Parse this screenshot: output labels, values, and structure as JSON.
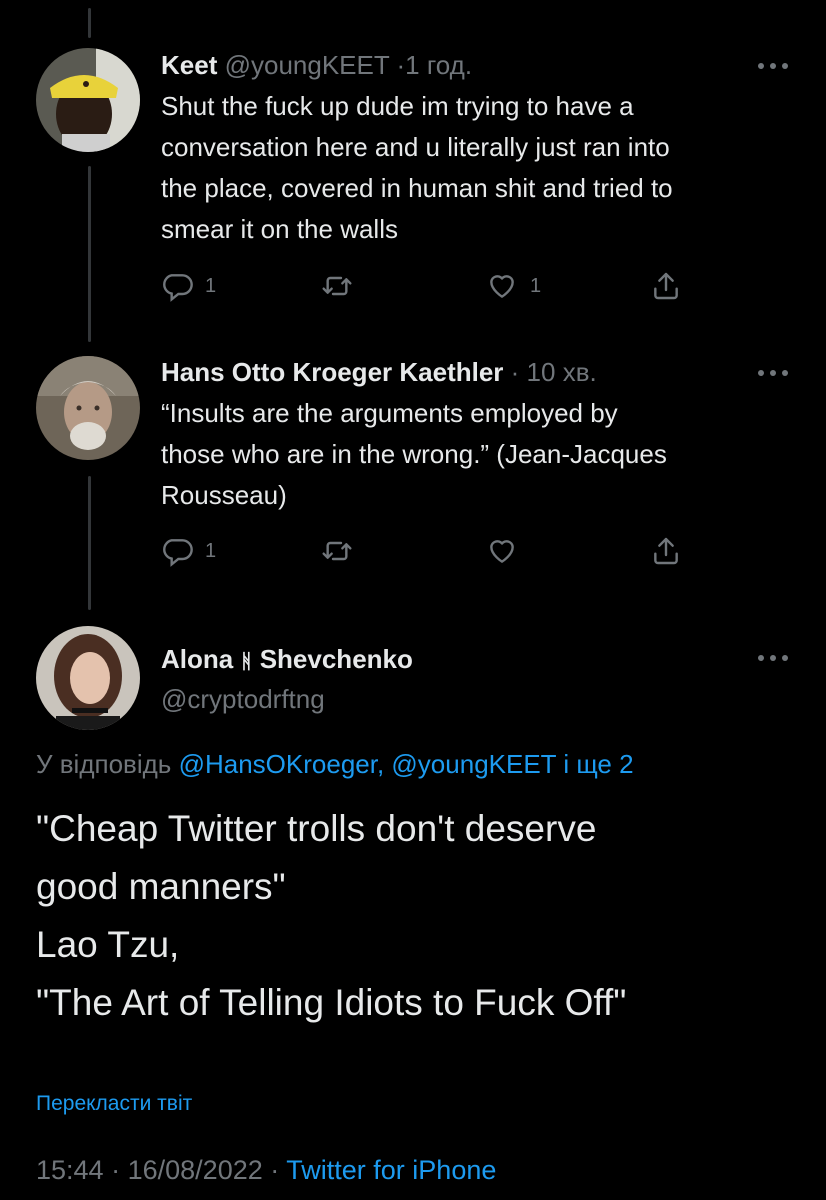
{
  "tweets": [
    {
      "name": "Keet",
      "handle": "@youngKEET",
      "time": "1 год.",
      "text": "Shut the fuck up dude im trying to have a\nconversation here and u literally just ran into\nthe place, covered in human shit and tried to\nsmear it on the walls",
      "reply_count": "1",
      "like_count": "1"
    },
    {
      "name": "Hans Otto Kroeger Kaethler",
      "time": "10 хв.",
      "text": "“Insults are the arguments employed by\nthose who are in the wrong.” (Jean-Jacques\nRousseau)",
      "reply_count": "1"
    }
  ],
  "main": {
    "name_first": "Alona",
    "name_glyph": "ᚻ",
    "name_last": "Shevchenko",
    "handle": "@cryptodrftng",
    "reply_prefix": "У відповідь",
    "reply_targets": "@HansOKroeger, @youngKEET і ще 2",
    "text": "\"Cheap Twitter trolls don't deserve\ngood manners\"\nLao Tzu,\n\"The Art of Telling Idiots to Fuck Off\"",
    "translate_label": "Перекласти твіт",
    "time": "15:44",
    "date": "16/08/2022",
    "source": "Twitter for iPhone"
  },
  "colors": {
    "background": "#000000",
    "text": "#e7e9ea",
    "muted": "#71767b",
    "link": "#1d9bf0"
  }
}
